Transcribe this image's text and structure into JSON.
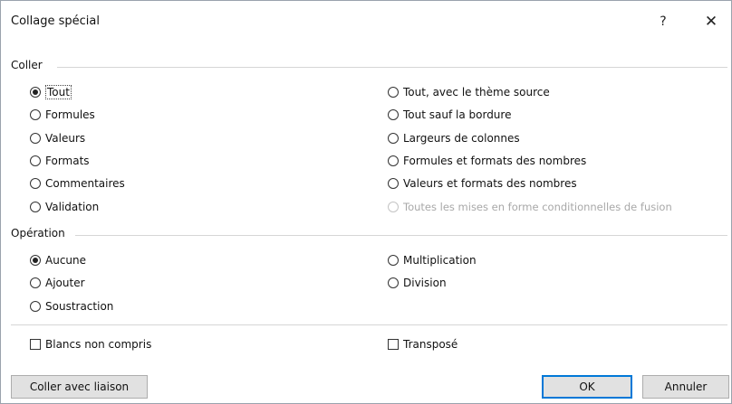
{
  "dialog": {
    "title": "Collage spécial",
    "help_label": "?",
    "close_label": "✕"
  },
  "coller": {
    "label": "Coller",
    "left": [
      {
        "label": "Tout",
        "checked": true
      },
      {
        "label": "Formules",
        "checked": false
      },
      {
        "label": "Valeurs",
        "checked": false
      },
      {
        "label": "Formats",
        "checked": false
      },
      {
        "label": "Commentaires",
        "checked": false
      },
      {
        "label": "Validation",
        "checked": false
      }
    ],
    "right": [
      {
        "label": "Tout, avec le thème source",
        "checked": false
      },
      {
        "label": "Tout sauf la bordure",
        "checked": false
      },
      {
        "label": "Largeurs de colonnes",
        "checked": false
      },
      {
        "label": "Formules et formats des nombres",
        "checked": false
      },
      {
        "label": "Valeurs et formats des nombres",
        "checked": false
      },
      {
        "label": "Toutes les mises en forme conditionnelles de fusion",
        "checked": false,
        "disabled": true
      }
    ]
  },
  "operation": {
    "label": "Opération",
    "left": [
      {
        "label": "Aucune",
        "checked": true
      },
      {
        "label": "Ajouter",
        "checked": false
      },
      {
        "label": "Soustraction",
        "checked": false
      }
    ],
    "right": [
      {
        "label": "Multiplication",
        "checked": false
      },
      {
        "label": "Division",
        "checked": false
      }
    ]
  },
  "checkboxes": {
    "blancs_label": "Blancs non compris",
    "blancs_checked": false,
    "transpose_label": "Transposé",
    "transpose_checked": false
  },
  "buttons": {
    "paste_link": "Coller avec liaison",
    "ok": "OK",
    "cancel": "Annuler"
  },
  "colors": {
    "default_button_border": "#0078d7",
    "disabled_text": "#a8a8a8"
  }
}
